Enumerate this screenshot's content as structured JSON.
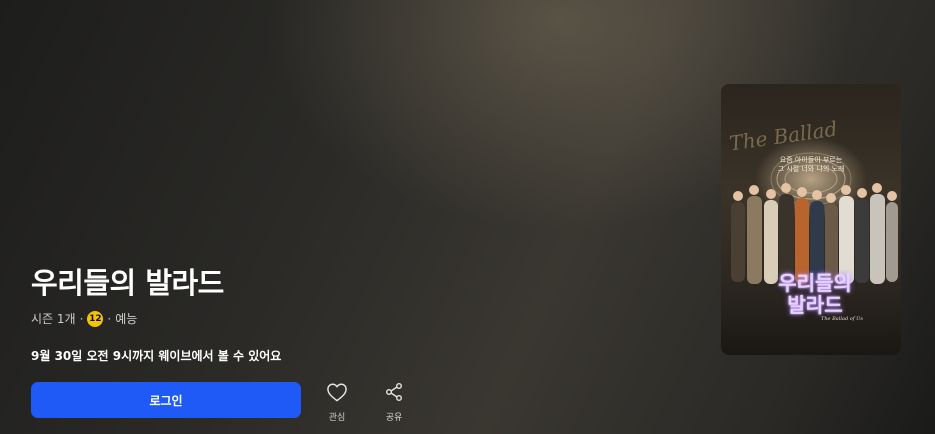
{
  "show": {
    "title": "우리들의 발라드",
    "season": "시즌 1개",
    "age_rating": "12",
    "genre": "예능",
    "availability_notice": "9월 30일 오전 9시까지 웨이브에서 볼 수 있어요"
  },
  "actions": {
    "login_label": "로그인",
    "like_label": "관심",
    "share_label": "공유"
  },
  "poster": {
    "tagline_line1": "요즘 아이들이 부르는",
    "tagline_line2": "그 시절 너와 나의 노래",
    "script_title": "The Ballad",
    "logo_line1": "우리들의",
    "logo_line2": "발라드",
    "logo_subtitle": "The Ballad of Us"
  },
  "colors": {
    "primary_button": "#1f5af7",
    "age_badge": "#f5c400"
  },
  "icons": {
    "like": "heart-icon",
    "share": "share-icon"
  }
}
